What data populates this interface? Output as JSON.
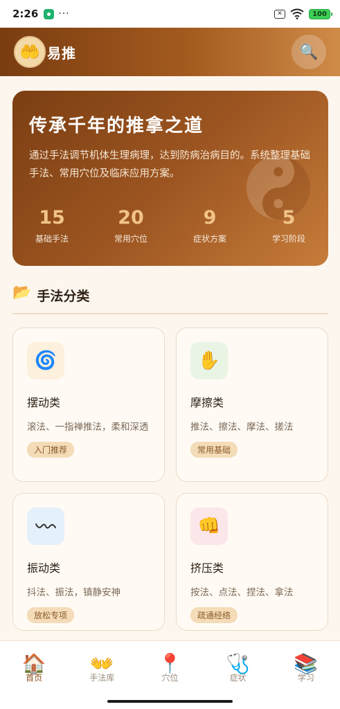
{
  "status_bar": {
    "time": "2:26",
    "dots": "···",
    "battery": "100"
  },
  "header": {
    "avatar_icon": "two-hands-icon",
    "title": "易推",
    "search_icon": "magnifier-icon"
  },
  "hero": {
    "title": "传承千年的推拿之道",
    "description": "通过手法调节机体生理病理，达到防病治病目的。系统整理基础手法、常用穴位及临床应用方案。",
    "decoration_icon": "yin-yang-icon",
    "stats": [
      {
        "value": "15",
        "label": "基础手法"
      },
      {
        "value": "20",
        "label": "常用穴位"
      },
      {
        "value": "9",
        "label": "症状方案"
      },
      {
        "value": "5",
        "label": "学习阶段"
      }
    ]
  },
  "section": {
    "icon": "folder-icon",
    "title": "手法分类"
  },
  "categories": [
    {
      "icon": "cyclone-icon",
      "name": "摆动类",
      "desc": "滚法、一指禅推法，柔和深透",
      "tag": "入门推荐",
      "icon_bg": "#fdf0dc"
    },
    {
      "icon": "raised-hand-icon",
      "name": "摩擦类",
      "desc": "推法、擦法、摩法、搓法",
      "tag": "常用基础",
      "icon_bg": "#e9f4e4"
    },
    {
      "icon": "wave-icon",
      "name": "振动类",
      "desc": "抖法、振法，镇静安神",
      "tag": "放松专项",
      "icon_bg": "#e4f0fb"
    },
    {
      "icon": "fist-icon",
      "name": "挤压类",
      "desc": "按法、点法、捏法、拿法",
      "tag": "疏通经络",
      "icon_bg": "#fbe6ea"
    }
  ],
  "nav": [
    {
      "icon": "house-icon",
      "label": "首页",
      "active": true
    },
    {
      "icon": "hands-icon",
      "label": "手法库",
      "active": false
    },
    {
      "icon": "pin-icon",
      "label": "穴位",
      "active": false
    },
    {
      "icon": "stethoscope-icon",
      "label": "症状",
      "active": false
    },
    {
      "icon": "books-icon",
      "label": "学习",
      "active": false
    }
  ],
  "colors": {
    "brand": "#8a4d18",
    "accent_number": "#f1c488",
    "tag_bg": "#f4dcb8",
    "page_bg": "#fcf6ee"
  }
}
